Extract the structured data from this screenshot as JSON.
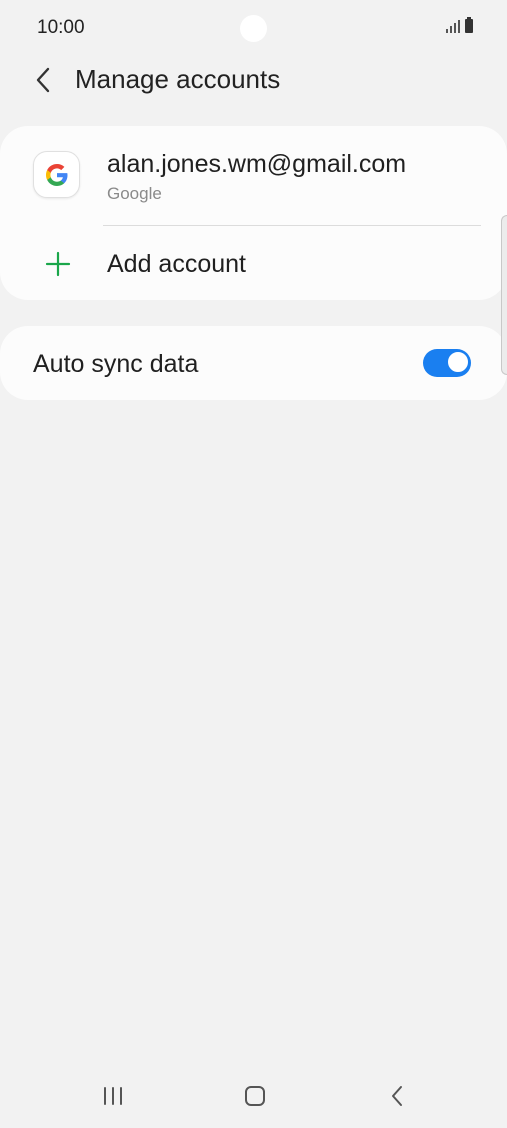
{
  "status_bar": {
    "time": "10:00"
  },
  "header": {
    "title": "Manage accounts",
    "back_icon": "chevron-left-icon"
  },
  "accounts": {
    "items": [
      {
        "email": "alan.jones.wm@gmail.com",
        "type": "Google",
        "icon": "google-g-icon"
      }
    ],
    "add_label": "Add account",
    "add_icon": "plus-icon"
  },
  "sync": {
    "label": "Auto sync data",
    "enabled": true
  },
  "colors": {
    "accent": "#1a7ff0",
    "plus": "#1aa64a",
    "background": "#f2f2f2",
    "card": "#fcfcfc"
  },
  "nav_bar": {
    "recents_icon": "recents-icon",
    "home_icon": "home-icon",
    "back_icon": "back-icon"
  }
}
